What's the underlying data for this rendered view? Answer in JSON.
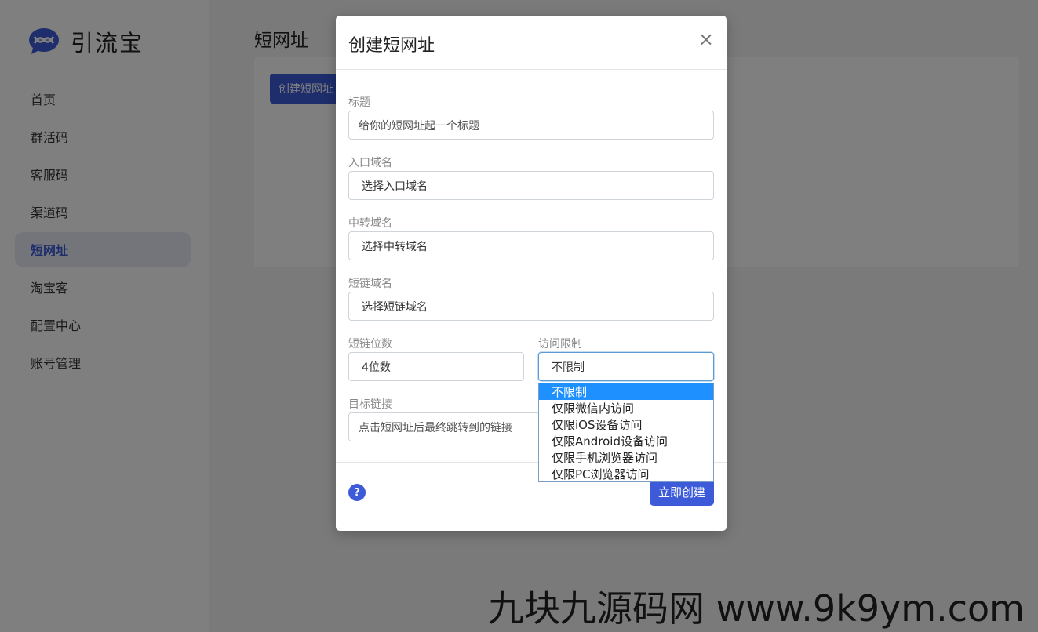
{
  "app": {
    "name": "引流宝",
    "colors": {
      "accent": "#3d5bd8",
      "selected": "#1e90ff"
    }
  },
  "sidebar": {
    "logo_icon": "chat-bubble-logo-icon",
    "items": [
      {
        "label": "首页"
      },
      {
        "label": "群活码"
      },
      {
        "label": "客服码"
      },
      {
        "label": "渠道码"
      },
      {
        "label": "短网址",
        "active": true
      },
      {
        "label": "淘宝客"
      },
      {
        "label": "配置中心"
      },
      {
        "label": "账号管理"
      }
    ]
  },
  "page": {
    "title": "短网址",
    "create_button": "创建短网址"
  },
  "modal": {
    "title": "创建短网址",
    "close_icon": "×",
    "fields": {
      "title": {
        "label": "标题",
        "placeholder": "给你的短网址起一个标题"
      },
      "entry_domain": {
        "label": "入口域名",
        "value": "选择入口域名"
      },
      "relay_domain": {
        "label": "中转域名",
        "value": "选择中转域名"
      },
      "short_domain": {
        "label": "短链域名",
        "value": "选择短链域名"
      },
      "digits": {
        "label": "短链位数",
        "value": "4位数"
      },
      "access": {
        "label": "访问限制",
        "value": "不限制"
      },
      "target": {
        "label": "目标链接",
        "placeholder": "点击短网址后最终跳转到的链接"
      }
    },
    "help_icon": "?",
    "submit_label": "立即创建"
  },
  "access_dropdown": {
    "options": [
      "不限制",
      "仅限微信内访问",
      "仅限iOS设备访问",
      "仅限Android设备访问",
      "仅限手机浏览器访问",
      "仅限PC浏览器访问"
    ],
    "selected_index": 0
  },
  "watermark": "九块九源码网 www.9k9ym.com"
}
